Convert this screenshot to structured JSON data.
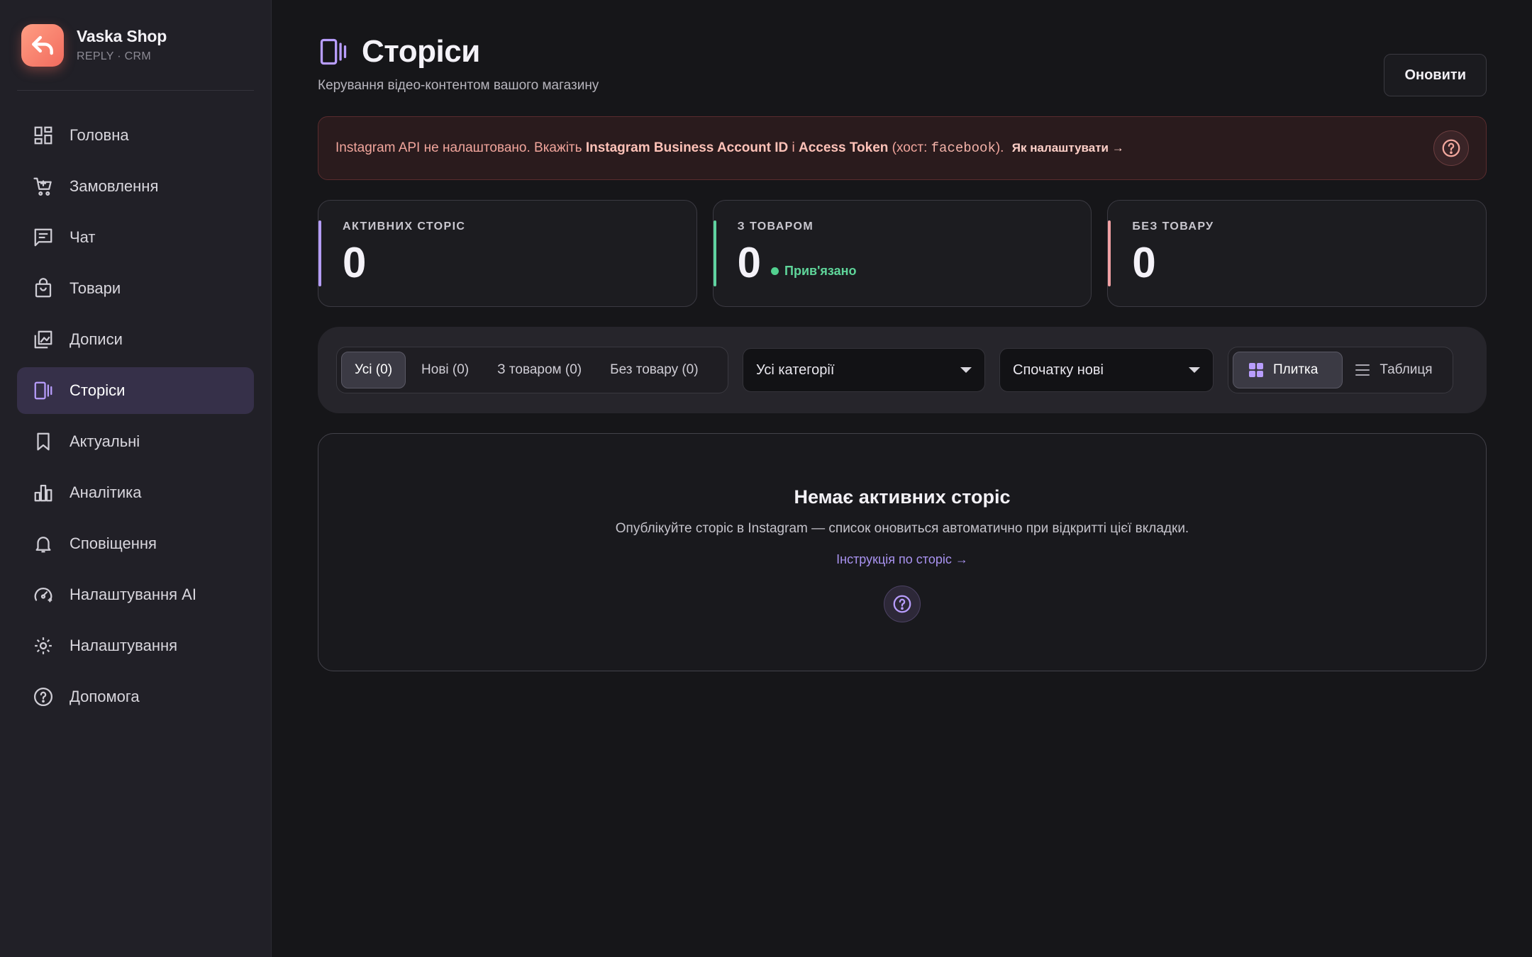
{
  "brand": {
    "name": "Vaska Shop",
    "sub": "REPLY · CRM"
  },
  "sidebar": {
    "items": [
      {
        "label": "Головна",
        "icon": "dashboard-icon"
      },
      {
        "label": "Замовлення",
        "icon": "cart-icon"
      },
      {
        "label": "Чат",
        "icon": "chat-icon"
      },
      {
        "label": "Товари",
        "icon": "shopping-bag-icon"
      },
      {
        "label": "Дописи",
        "icon": "gallery-icon"
      },
      {
        "label": "Сторіси",
        "icon": "stories-icon",
        "active": true
      },
      {
        "label": "Актуальні",
        "icon": "bookmark-icon"
      },
      {
        "label": "Аналітика",
        "icon": "bar-chart-icon"
      },
      {
        "label": "Сповіщення",
        "icon": "bell-icon"
      },
      {
        "label": "Налаштування AI",
        "icon": "ai-settings-icon"
      },
      {
        "label": "Налаштування",
        "icon": "gear-icon"
      },
      {
        "label": "Допомога",
        "icon": "help-icon"
      }
    ]
  },
  "header": {
    "title": "Сторіси",
    "subtitle": "Керування відео-контентом вашого магазину",
    "refresh_label": "Оновити"
  },
  "alert": {
    "text_before": "Instagram API не налаштовано. Вкажіть ",
    "field1": "Instagram Business Account ID",
    "and": " і ",
    "field2": "Access Token",
    "host_before": " (хост: ",
    "host": "facebook",
    "host_after": ").",
    "link": "Як налаштувати →"
  },
  "stats": [
    {
      "label": "АКТИВНИХ СТОРІС",
      "value": "0",
      "accent": "#b49cf5"
    },
    {
      "label": "З ТОВАРОМ",
      "value": "0",
      "badge": "Прив'язано",
      "accent": "#5fd3a0"
    },
    {
      "label": "БЕЗ ТОВАРУ",
      "value": "0",
      "accent": "#f0a0a3"
    }
  ],
  "filters": {
    "tabs": [
      {
        "label": "Усі (0)",
        "active": true
      },
      {
        "label": "Нові (0)"
      },
      {
        "label": "З товаром (0)"
      },
      {
        "label": "Без товару (0)"
      }
    ],
    "category": "Усі категорії",
    "sort": "Спочатку нові",
    "view_tile": "Плитка",
    "view_table": "Таблиця"
  },
  "empty": {
    "title": "Немає активних сторіс",
    "text": "Опублікуйте сторіс в Instagram — список оновиться автоматично при відкритті цієї вкладки.",
    "link": "Інструкція по сторіс →"
  },
  "colors": {
    "accent": "#b89dfd",
    "alert": "#f1a59c",
    "success": "#52d08f"
  }
}
